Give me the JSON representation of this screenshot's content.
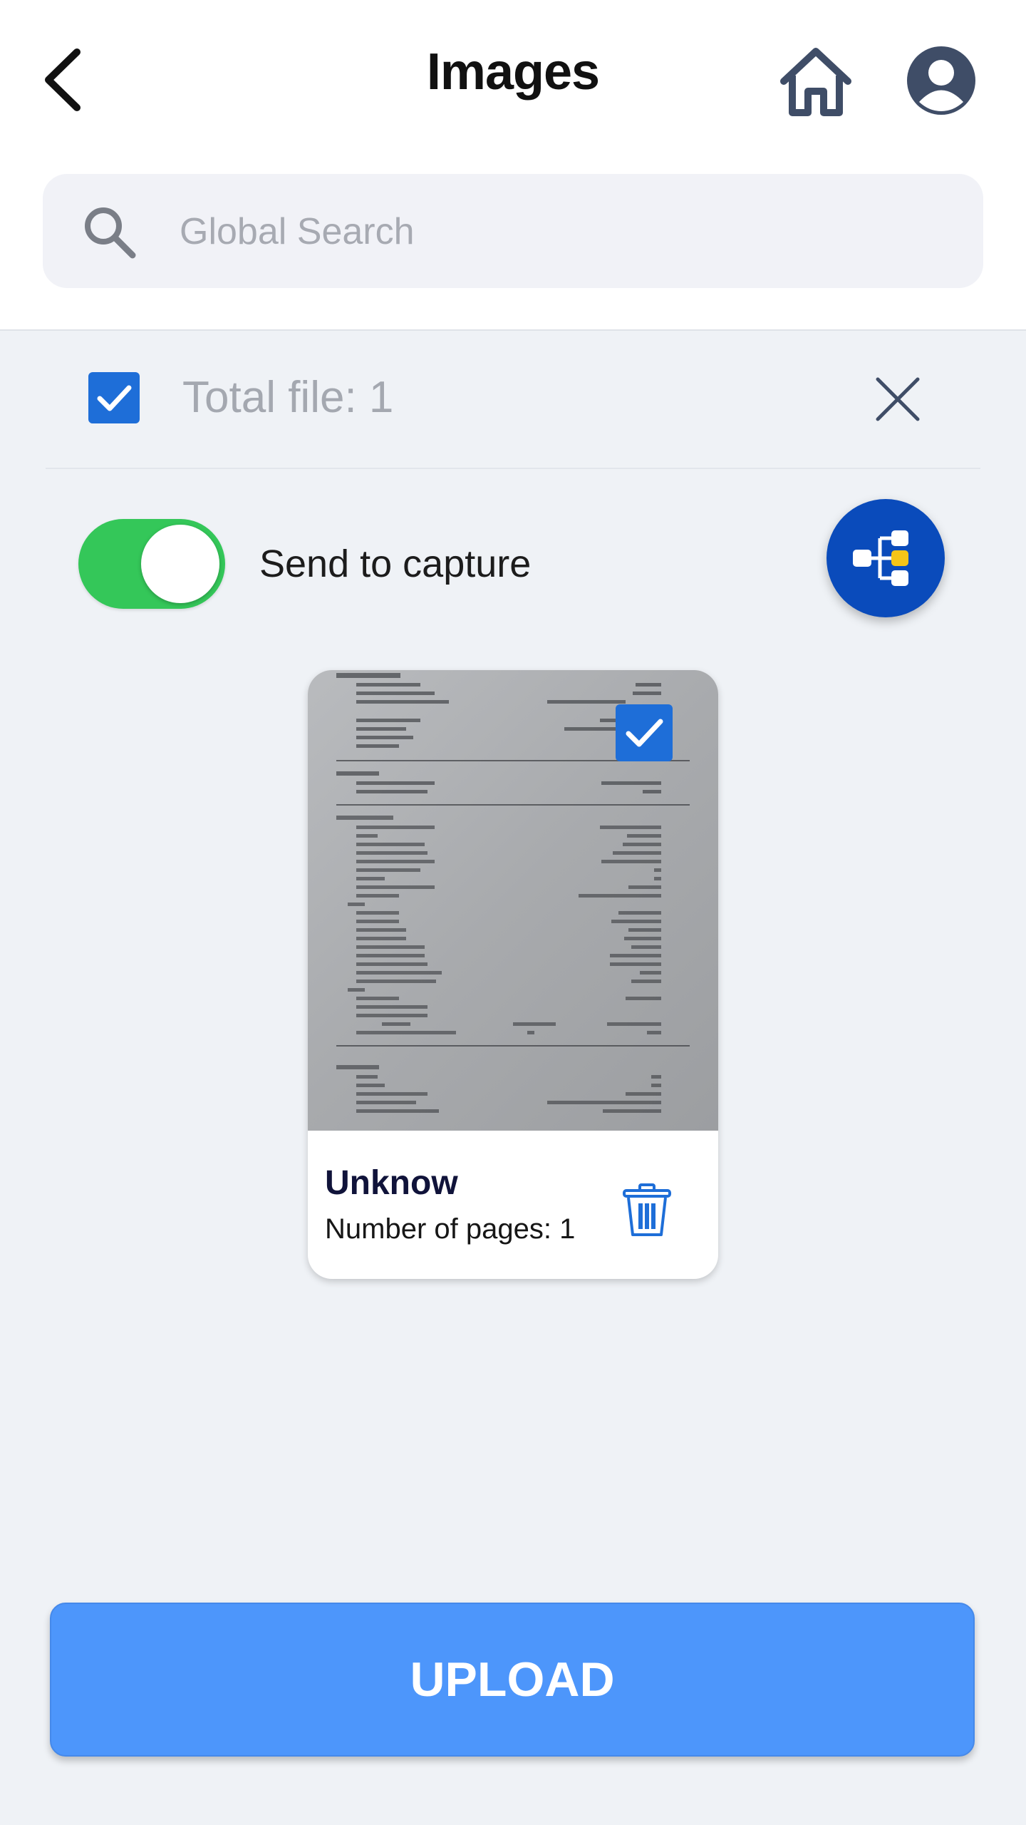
{
  "header": {
    "title": "Images"
  },
  "search": {
    "placeholder": "Global Search"
  },
  "selection": {
    "total_label": "Total file: 1",
    "all_selected": true
  },
  "capture": {
    "label": "Send to capture",
    "enabled": true
  },
  "files": [
    {
      "title": "Unknow",
      "pages_label": "Number of pages: 1",
      "selected": true
    }
  ],
  "actions": {
    "upload_label": "UPLOAD"
  },
  "colors": {
    "accent": "#1e6ed8",
    "toggle_on": "#34c759",
    "workflow_button": "#0a4bbb",
    "upload_button": "#4d96fb",
    "icon_dark": "#3f4d67"
  },
  "icons": [
    "back-arrow-icon",
    "home-icon",
    "profile-icon",
    "search-icon",
    "checkmark-icon",
    "close-icon",
    "workflow-icon",
    "trash-icon"
  ]
}
